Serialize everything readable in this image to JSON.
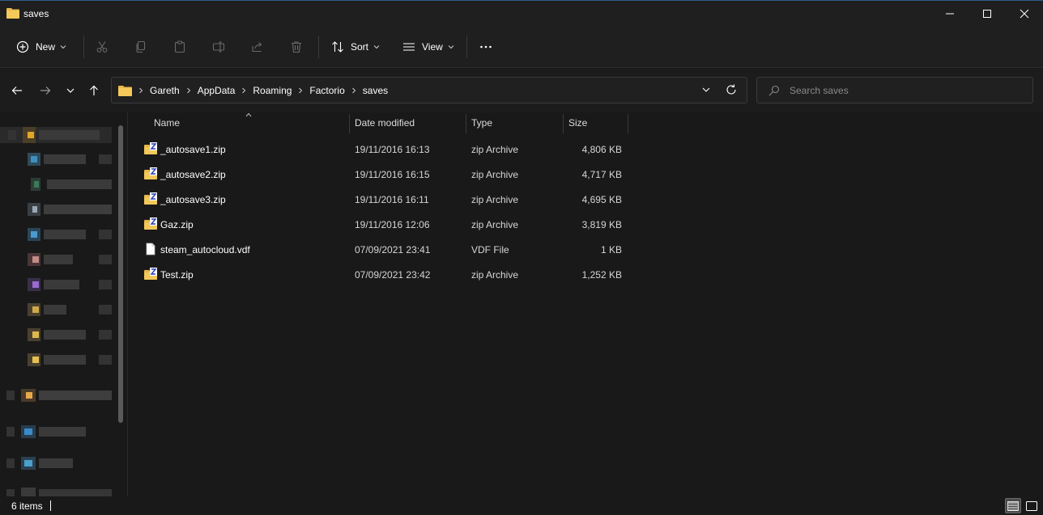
{
  "window": {
    "title": "saves",
    "accent_color": "#2a5d8a",
    "folder_color": "#e8b84a"
  },
  "toolbar": {
    "new_label": "New",
    "sort_label": "Sort",
    "view_label": "View",
    "icons": [
      "plus-circle-icon",
      "cut-icon",
      "copy-icon",
      "paste-icon",
      "rename-icon",
      "share-icon",
      "delete-icon",
      "sort-icon",
      "view-icon",
      "more-icon"
    ]
  },
  "address": {
    "crumbs": [
      "Gareth",
      "AppData",
      "Roaming",
      "Factorio",
      "saves"
    ]
  },
  "search": {
    "placeholder": "Search saves"
  },
  "columns": {
    "name": "Name",
    "date": "Date modified",
    "type": "Type",
    "size": "Size"
  },
  "files": [
    {
      "name": "_autosave1.zip",
      "date": "19/11/2016 16:13",
      "type": "zip Archive",
      "size": "4,806 KB",
      "icon": "zip-folder-icon"
    },
    {
      "name": "_autosave2.zip",
      "date": "19/11/2016 16:15",
      "type": "zip Archive",
      "size": "4,717 KB",
      "icon": "zip-folder-icon"
    },
    {
      "name": "_autosave3.zip",
      "date": "19/11/2016 16:11",
      "type": "zip Archive",
      "size": "4,695 KB",
      "icon": "zip-folder-icon"
    },
    {
      "name": "Gaz.zip",
      "date": "19/11/2016 12:06",
      "type": "zip Archive",
      "size": "3,819 KB",
      "icon": "zip-folder-icon"
    },
    {
      "name": "steam_autocloud.vdf",
      "date": "07/09/2021 23:41",
      "type": "VDF File",
      "size": "1 KB",
      "icon": "file-icon"
    },
    {
      "name": "Test.zip",
      "date": "07/09/2021 23:42",
      "type": "zip Archive",
      "size": "1,252 KB",
      "icon": "zip-folder-icon"
    }
  ],
  "status": {
    "item_count": "6 items"
  }
}
